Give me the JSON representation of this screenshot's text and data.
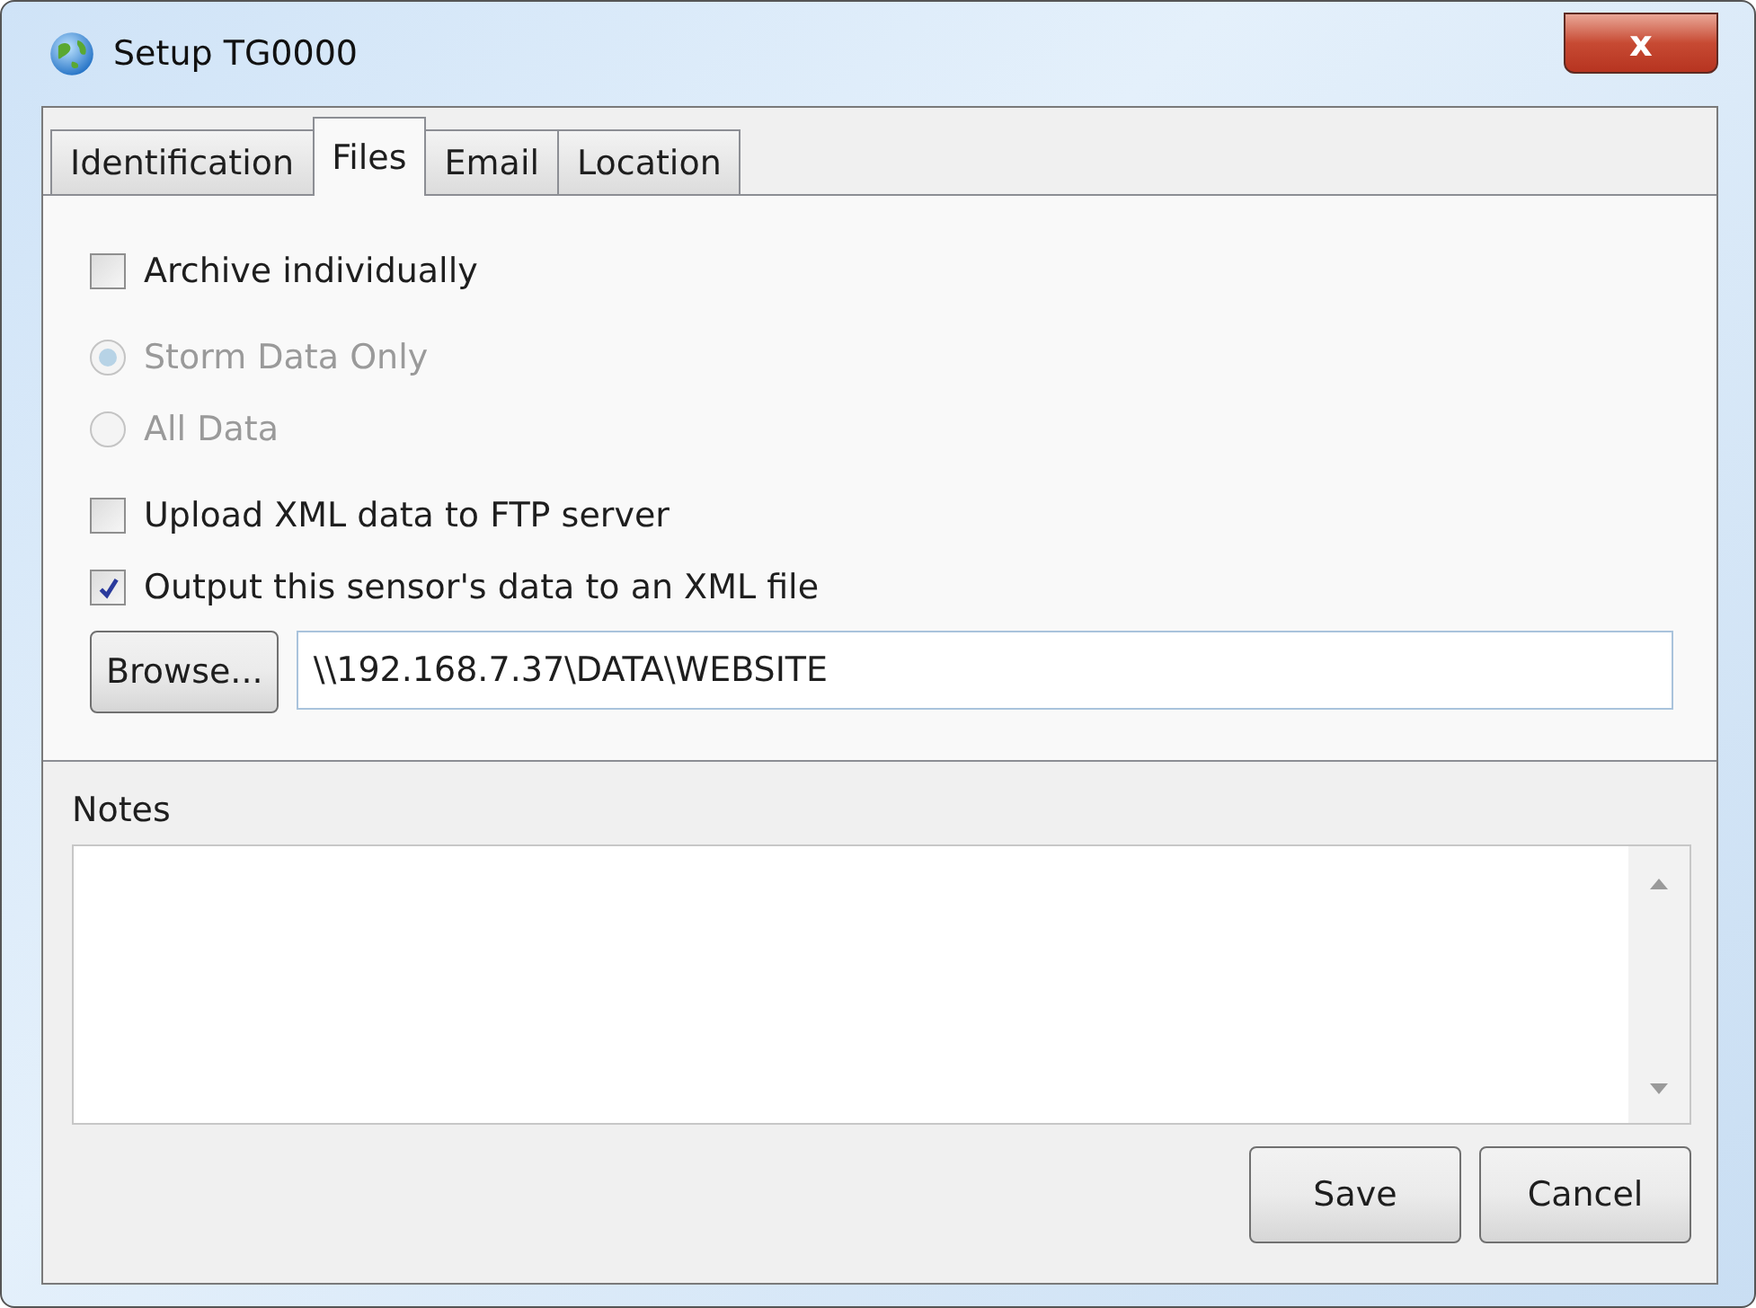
{
  "window": {
    "title": "Setup TG0000",
    "close_button": "x"
  },
  "tabs": [
    {
      "label": "Identification",
      "selected": false
    },
    {
      "label": "Files",
      "selected": true
    },
    {
      "label": "Email",
      "selected": false
    },
    {
      "label": "Location",
      "selected": false
    }
  ],
  "options": [
    {
      "kind": "checkbox",
      "label": "Archive individually",
      "checked": false,
      "disabled": false
    },
    {
      "kind": "radio",
      "label": "Storm Data Only",
      "selected": true,
      "disabled": true
    },
    {
      "kind": "radio",
      "label": "All Data",
      "selected": false,
      "disabled": true
    },
    {
      "kind": "checkbox",
      "label": "Upload XML data to FTP server",
      "checked": false,
      "disabled": false
    },
    {
      "kind": "checkbox",
      "label": "Output this sensor's data to an XML file",
      "checked": true,
      "disabled": false
    }
  ],
  "browse_button": "Browse...",
  "path_field": {
    "value": "\\\\192.168.7.37\\DATA\\WEBSITE"
  },
  "notes": {
    "label": "Notes"
  },
  "buttons": [
    "Save",
    "Cancel"
  ]
}
